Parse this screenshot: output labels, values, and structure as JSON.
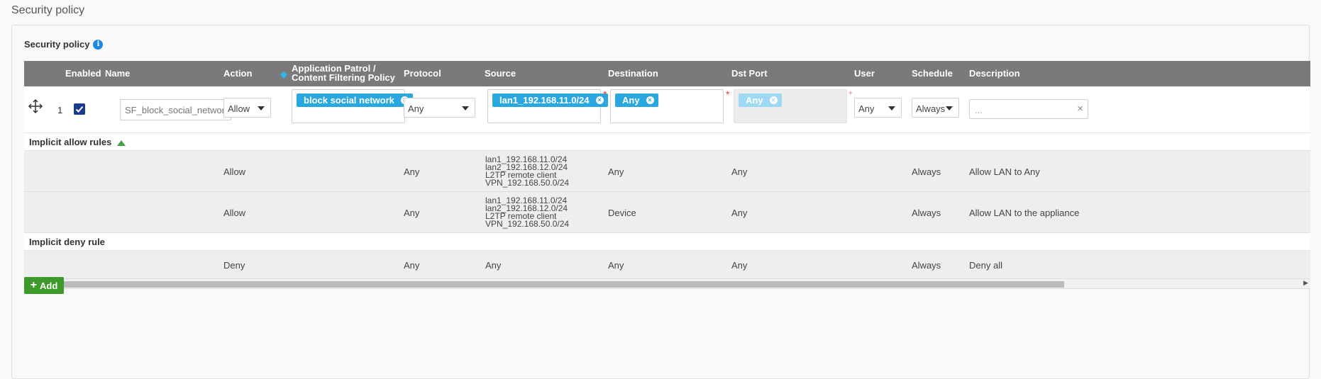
{
  "page": {
    "title": "Security policy"
  },
  "card": {
    "title": "Security policy"
  },
  "table": {
    "headers": {
      "enabled": "Enabled",
      "name": "Name",
      "action": "Action",
      "app_line1": "Application Patrol /",
      "app_line2": "Content Filtering Policy",
      "protocol": "Protocol",
      "source": "Source",
      "destination": "Destination",
      "dst_port": "Dst Port",
      "user": "User",
      "schedule": "Schedule",
      "description": "Description"
    },
    "edit_row": {
      "number": "1",
      "enabled": true,
      "name_value": "SF_block_social_network",
      "action": "Allow",
      "app_tag": "block social network",
      "protocol": "Any",
      "source_tag": "lan1_192.168.11.0/24",
      "destination_tag": "Any",
      "dst_port_tag": "Any",
      "user": "Any",
      "schedule": "Always",
      "description_placeholder": "..."
    },
    "groups": {
      "implicit_allow": "Implicit allow rules",
      "implicit_deny": "Implicit deny rule"
    },
    "allow_rows": [
      {
        "action": "Allow",
        "protocol": "Any",
        "source": [
          "lan1_192.168.11.0/24",
          "lan2_192.168.12.0/24",
          "L2TP remote client",
          "VPN_192.168.50.0/24"
        ],
        "destination": "Any",
        "dst_port": "Any",
        "schedule": "Always",
        "description": "Allow LAN to Any"
      },
      {
        "action": "Allow",
        "protocol": "Any",
        "source": [
          "lan1_192.168.11.0/24",
          "lan2_192.168.12.0/24",
          "L2TP remote client",
          "VPN_192.168.50.0/24"
        ],
        "destination": "Device",
        "dst_port": "Any",
        "schedule": "Always",
        "description": "Allow LAN to the appliance"
      }
    ],
    "deny_row": {
      "action": "Deny",
      "protocol": "Any",
      "source": "Any",
      "destination": "Any",
      "dst_port": "Any",
      "schedule": "Always",
      "description": "Deny all"
    }
  },
  "buttons": {
    "add": "Add"
  },
  "colors": {
    "header_bg": "#7a7a7a",
    "tag": "#29a8e0",
    "add_button": "#3d9a2a",
    "checkbox": "#1a3c8f"
  }
}
